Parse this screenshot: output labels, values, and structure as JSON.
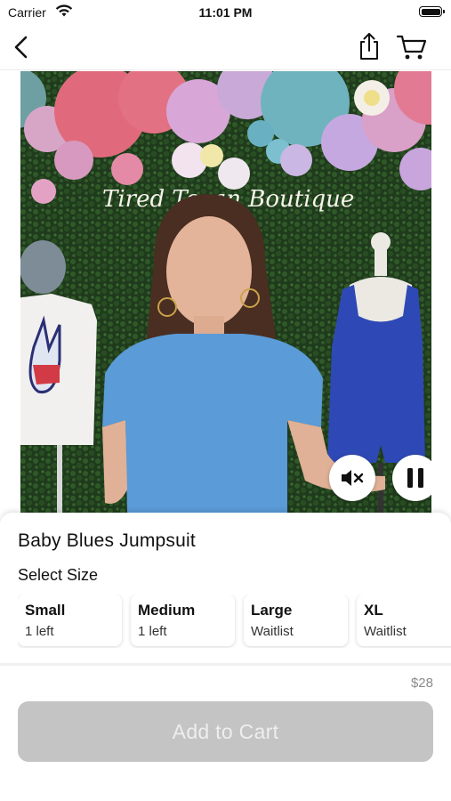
{
  "status_bar": {
    "carrier": "Carrier",
    "time": "11:01 PM",
    "wifi_icon": "wifi-icon",
    "battery_icon": "battery-full-icon"
  },
  "nav": {
    "back_icon": "chevron-left-icon",
    "share_icon": "share-icon",
    "cart_icon": "cart-icon"
  },
  "video": {
    "neon_sign": "Tired Texan Boutique",
    "mute_icon": "speaker-muted-icon",
    "pause_icon": "pause-icon"
  },
  "product": {
    "title": "Baby Blues Jumpsuit",
    "select_size_label": "Select Size",
    "sizes": [
      {
        "name": "Small",
        "status": "1 left"
      },
      {
        "name": "Medium",
        "status": "1 left"
      },
      {
        "name": "Large",
        "status": "Waitlist"
      },
      {
        "name": "XL",
        "status": "Waitlist"
      }
    ],
    "price": "$28",
    "add_to_cart_label": "Add to Cart"
  },
  "colors": {
    "button_disabled": "#c4c4c4",
    "button_text": "#eeeeee",
    "price_text": "#8a8a8a"
  }
}
